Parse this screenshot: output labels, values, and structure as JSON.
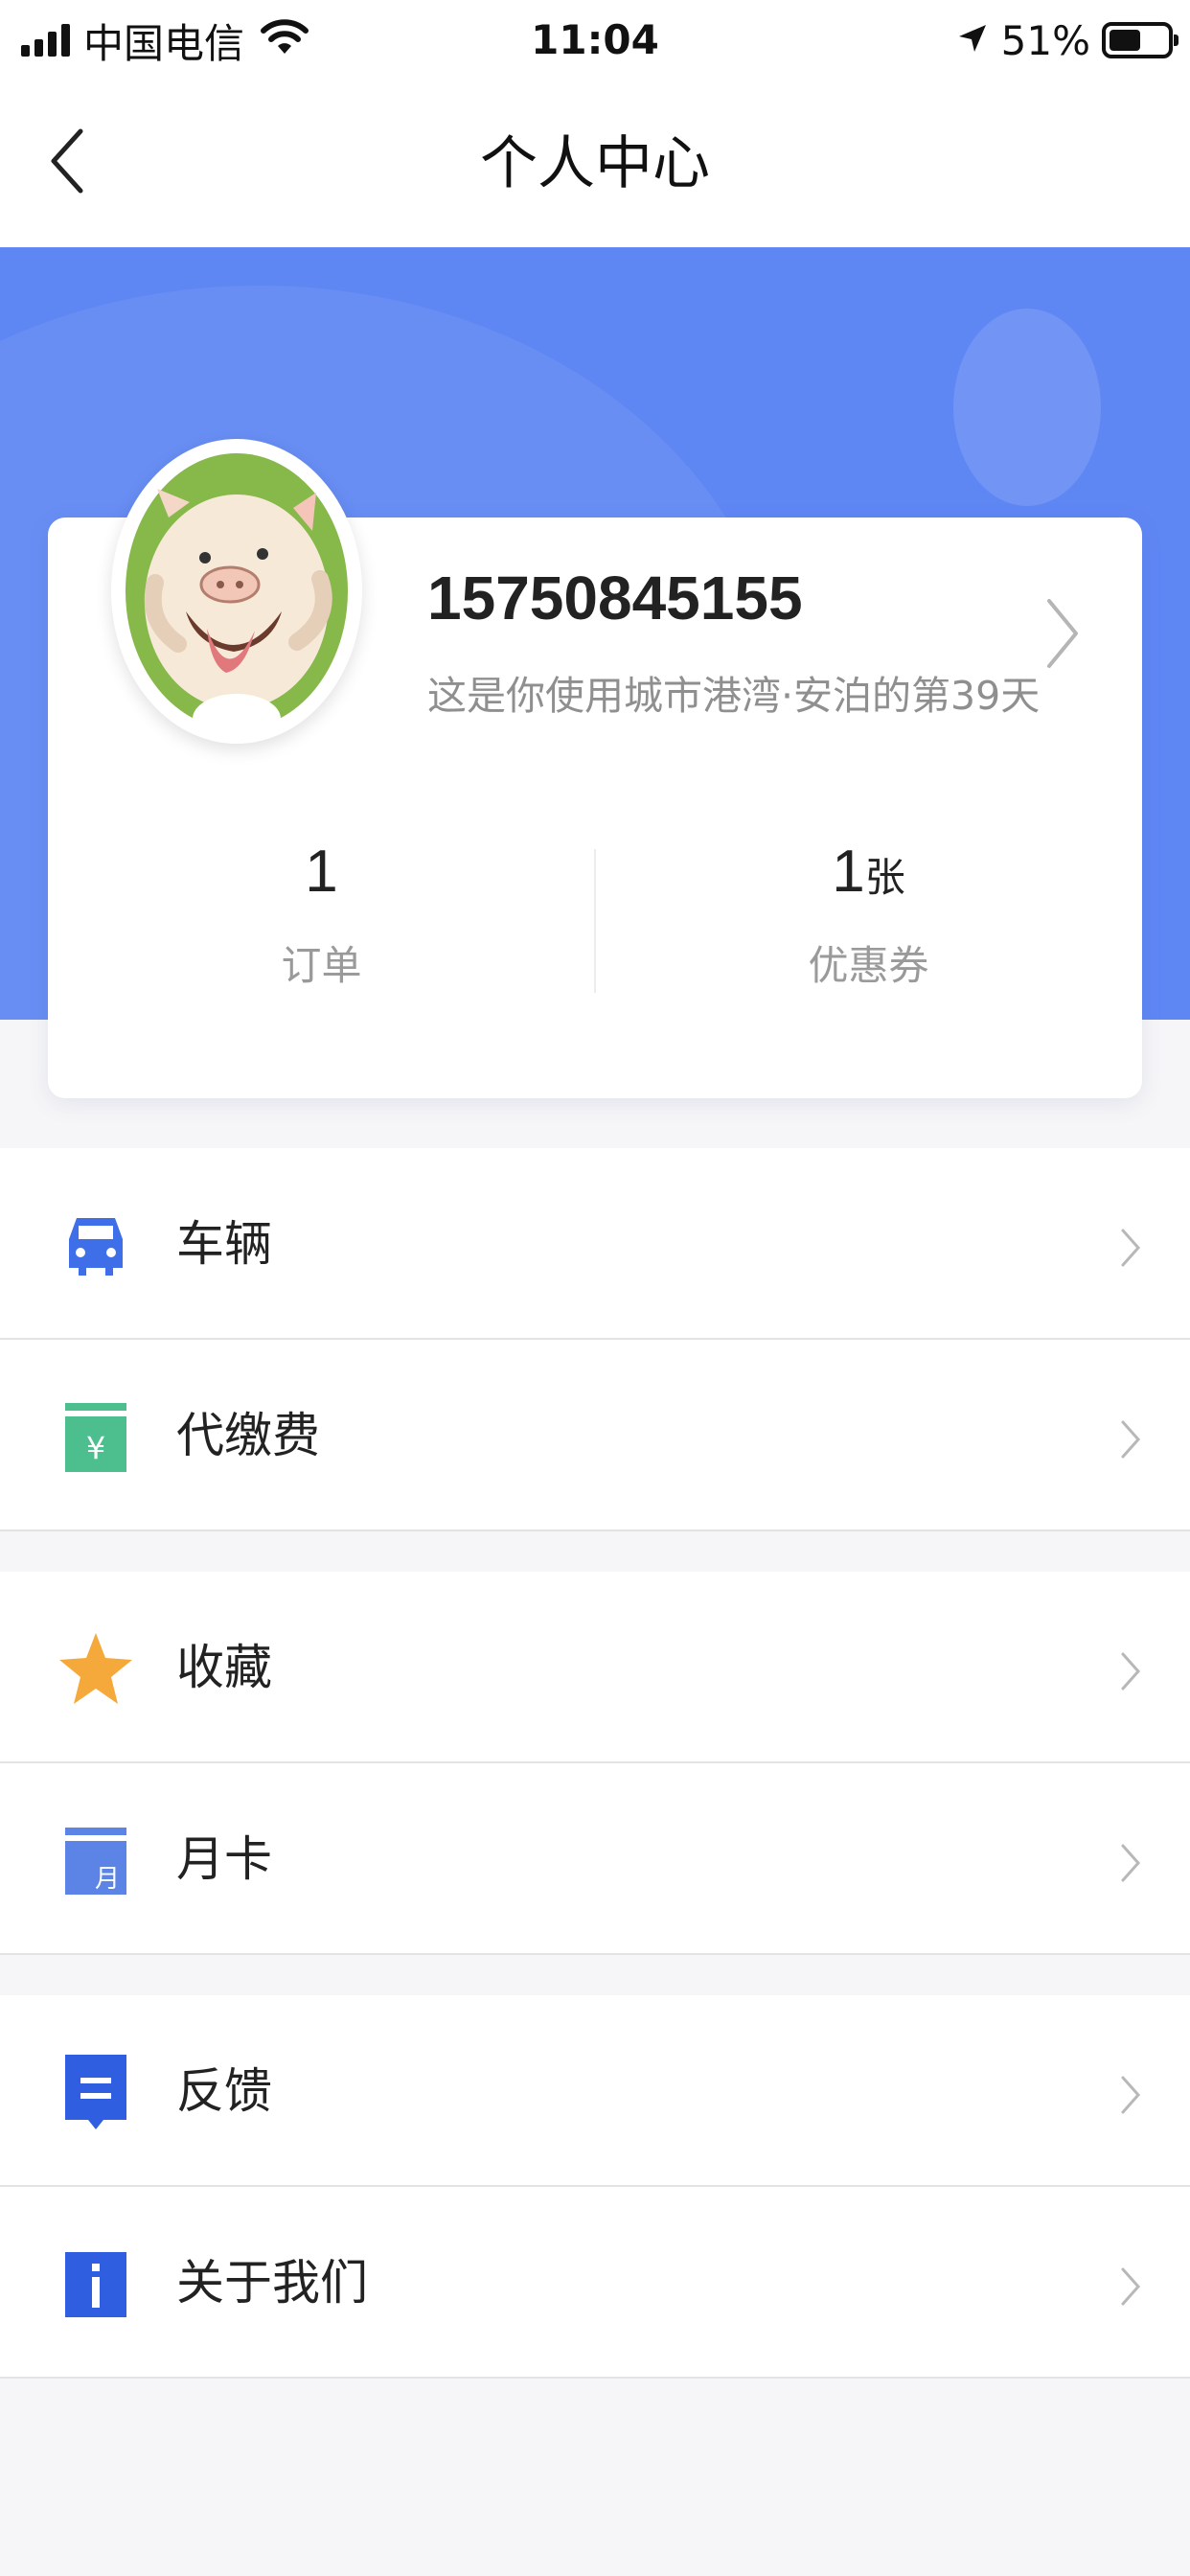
{
  "status_bar": {
    "carrier": "中国电信",
    "time": "11:04",
    "battery_percent": "51%",
    "battery_level": 0.51,
    "icons": [
      "signal-icon",
      "wifi-icon",
      "location-arrow-icon",
      "battery-icon"
    ]
  },
  "nav": {
    "title": "个人中心",
    "back_icon": "chevron-left-icon"
  },
  "profile": {
    "phone": "15750845155",
    "days_text": "这是你使用城市港湾·安泊的第39天",
    "avatar_icon": "cartoon-pig-avatar",
    "arrow_icon": "chevron-right-icon"
  },
  "stats": [
    {
      "value": "1",
      "unit": "",
      "label": "订单"
    },
    {
      "value": "1",
      "unit": "张",
      "label": "优惠券"
    }
  ],
  "menu_groups": [
    [
      {
        "label": "车辆",
        "icon": "car-icon",
        "color": "#3f6fe8"
      },
      {
        "label": "代缴费",
        "icon": "payment-yuan-icon",
        "color": "#4dbf8f"
      }
    ],
    [
      {
        "label": "收藏",
        "icon": "star-icon",
        "color": "#f5a93a"
      },
      {
        "label": "月卡",
        "icon": "monthly-card-icon",
        "color": "#5b84e6",
        "icon_text": "月"
      }
    ],
    [
      {
        "label": "反馈",
        "icon": "feedback-icon",
        "color": "#2f5fe0"
      },
      {
        "label": "关于我们",
        "icon": "info-icon",
        "color": "#2f5fe0"
      }
    ]
  ],
  "colors": {
    "banner": "#5f87f4",
    "background": "#f6f6f8"
  }
}
